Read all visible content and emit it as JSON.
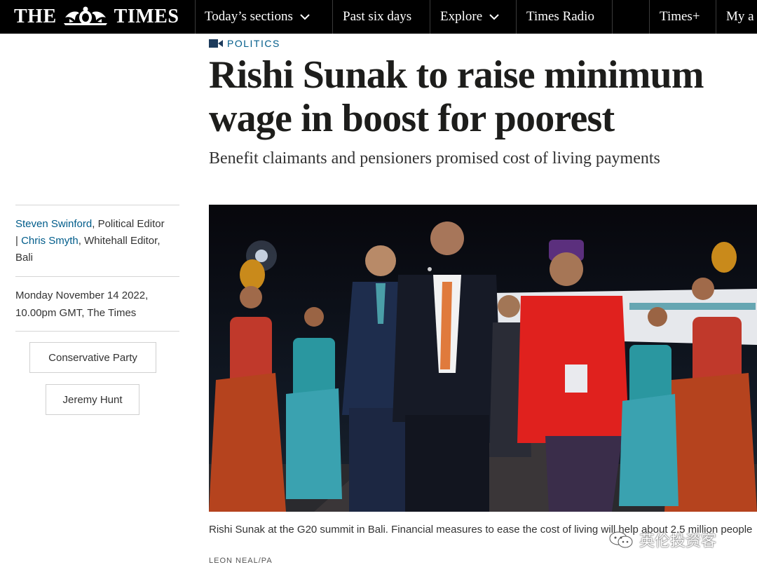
{
  "masthead": {
    "logo_left": "THE",
    "logo_right": "TIMES"
  },
  "nav": {
    "todays_sections": "Today’s sections",
    "past_six_days": "Past six days",
    "explore": "Explore",
    "times_radio": "Times Radio",
    "times_plus": "Times+",
    "my_account": "My a"
  },
  "article": {
    "section": "POLITICS",
    "headline": "Rishi Sunak to raise minimum wage in boost for poorest",
    "standfirst": "Benefit claimants and pensioners promised cost of living payments",
    "byline": {
      "author1": "Steven Swinford",
      "role1": ", Political Editor",
      "sep": "| ",
      "author2": "Chris Smyth",
      "role2": ", Whitehall Editor,",
      "location": "Bali"
    },
    "date_line1": "Monday November 14 2022,",
    "date_line2": "10.00pm GMT, The Times",
    "topics": [
      "Conservative Party",
      "Jeremy Hunt"
    ],
    "caption": "Rishi Sunak at the G20 summit in Bali. Financial measures to ease the cost of living will help about 2.5 million people",
    "credit": "LEON NEAL/PA"
  },
  "watermark": {
    "text": "英伦投资客"
  },
  "colors": {
    "nav_bg": "#000000",
    "link_blue": "#005c8a",
    "headline": "#1d1d1b",
    "rule": "#d6d6d6"
  },
  "icons": {
    "section_icon": "video-camera-icon",
    "dropdown": "chevron-down-icon",
    "crest": "royal-crest-icon",
    "watermark": "wechat-icon"
  }
}
